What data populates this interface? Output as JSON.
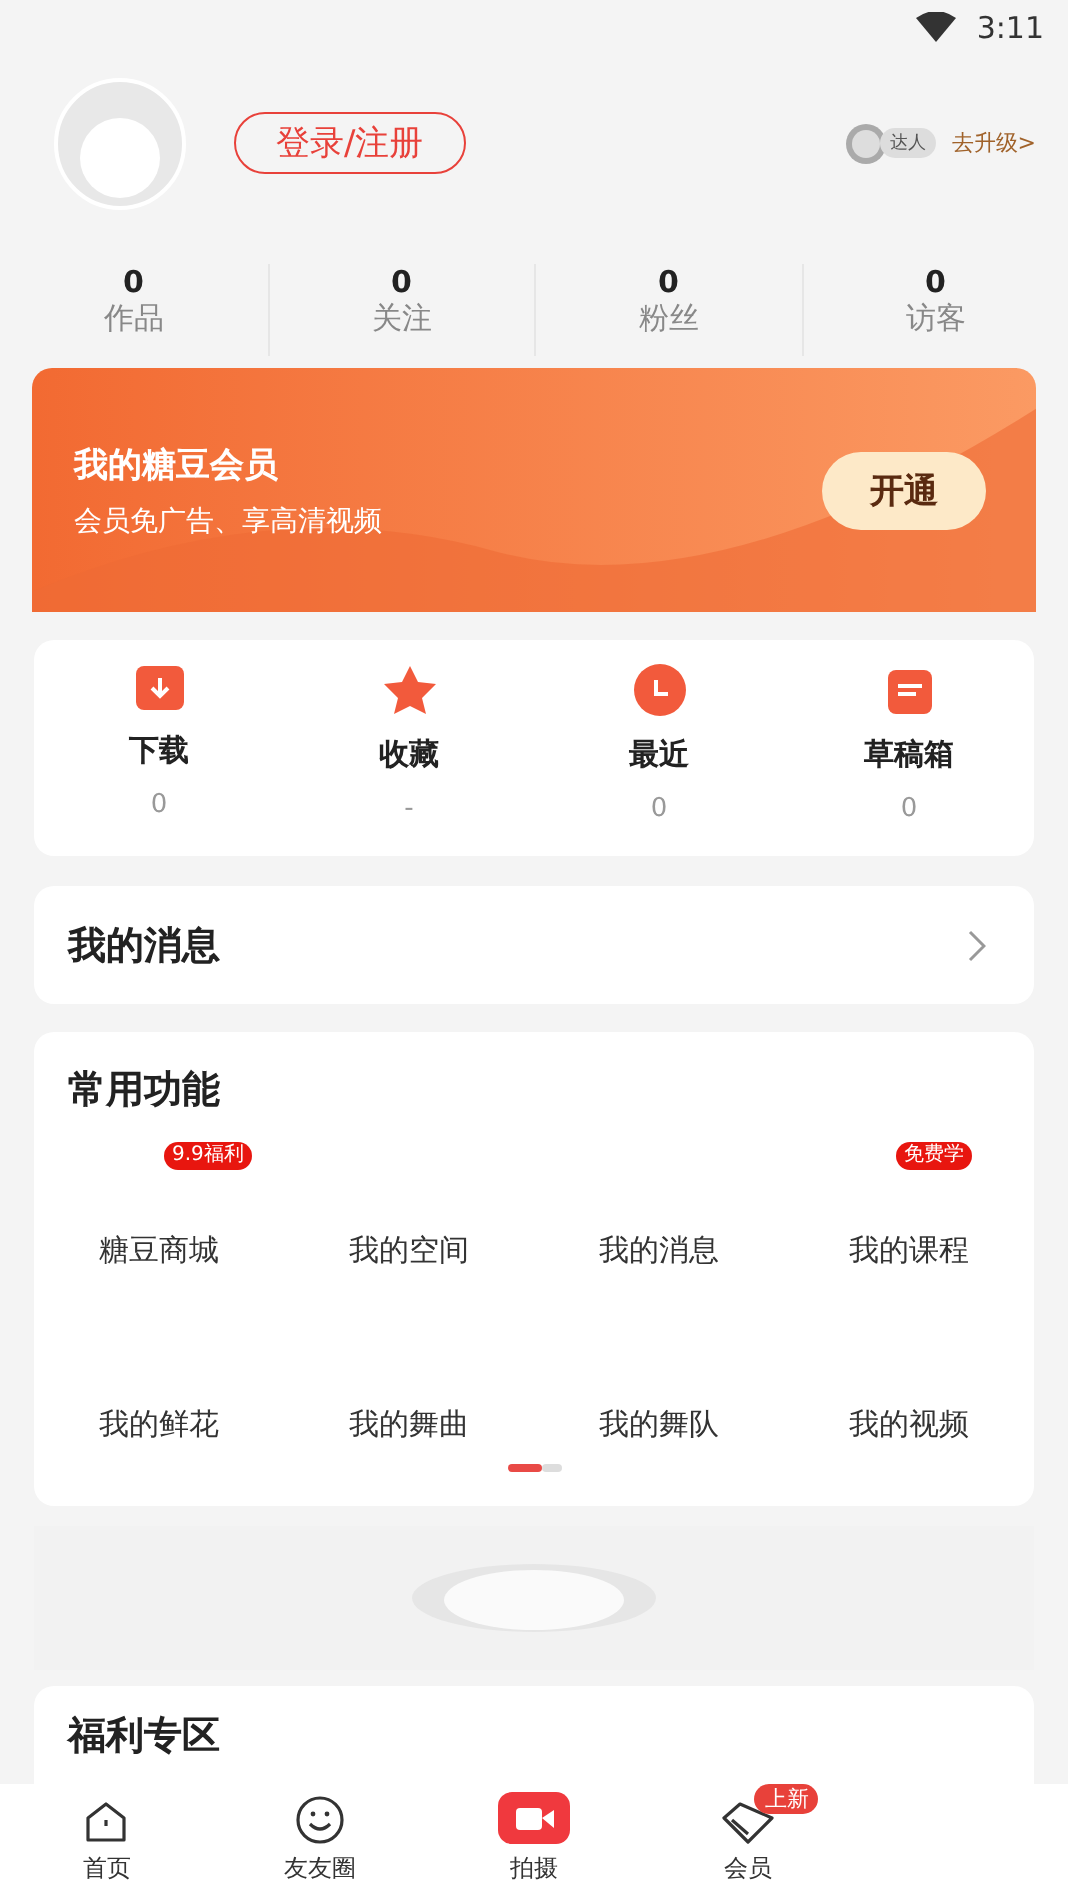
{
  "status_bar": {
    "time": "3:11"
  },
  "profile": {
    "login_button": "登录/注册",
    "level_badge": "达人",
    "upgrade_link": "去升级>"
  },
  "stats": [
    {
      "value": "0",
      "label": "作品"
    },
    {
      "value": "0",
      "label": "关注"
    },
    {
      "value": "0",
      "label": "粉丝"
    },
    {
      "value": "0",
      "label": "访客"
    }
  ],
  "vip_banner": {
    "title": "我的糖豆会员",
    "subtitle": "会员免广告、享高清视频",
    "button": "开通"
  },
  "shortcuts": [
    {
      "kind": "download",
      "label": "下载",
      "count": "0"
    },
    {
      "kind": "star",
      "label": "收藏",
      "count": "-"
    },
    {
      "kind": "clock",
      "label": "最近",
      "count": "0"
    },
    {
      "kind": "drafts",
      "label": "草稿箱",
      "count": "0"
    }
  ],
  "messages": {
    "title": "我的消息"
  },
  "functions": {
    "title": "常用功能",
    "items": [
      {
        "label": "糖豆商城",
        "badge": "9.9福利"
      },
      {
        "label": "我的空间"
      },
      {
        "label": "我的消息"
      },
      {
        "label": "我的课程",
        "badge": "免费学"
      },
      {
        "label": "我的鲜花"
      },
      {
        "label": "我的舞曲"
      },
      {
        "label": "我的舞队"
      },
      {
        "label": "我的视频"
      }
    ],
    "pages": [
      {
        "selected": true
      },
      {
        "selected": false
      }
    ]
  },
  "welfare": {
    "title": "福利专区"
  },
  "bottom_nav": [
    {
      "kind": "home",
      "label": "首页"
    },
    {
      "kind": "smile",
      "label": "友友圈"
    },
    {
      "kind": "camera",
      "label": "拍摄"
    },
    {
      "kind": "vip",
      "label": "会员",
      "badge": "上新"
    }
  ]
}
